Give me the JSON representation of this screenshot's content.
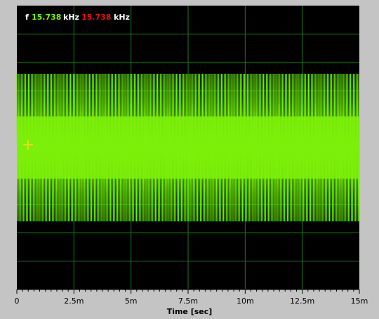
{
  "readout": {
    "f_label": "f",
    "freq_green": "15.738",
    "unit_green": "kHz",
    "freq_red": "15.738",
    "unit_red": "kHz"
  },
  "colors": {
    "trace": "#6cf500",
    "trace_dense": "#7df00a",
    "grid": "#1e7a1e",
    "background": "#000000",
    "label_green": "#7cf000",
    "label_red": "#e01010",
    "cursor": "#f0e020"
  },
  "chart_data": {
    "type": "line",
    "title": "",
    "xlabel": "Time [sec]",
    "ylabel": "",
    "x_ticks": [
      "0",
      "2.5m",
      "5m",
      "7.5m",
      "10m",
      "12.5m",
      "15m"
    ],
    "xlim": [
      0,
      0.015
    ],
    "grid": true,
    "series": [
      {
        "frequency_hz": 15738,
        "x_start": 0,
        "x_end": 0.015,
        "envelope_outer": [
          -0.52,
          0.52
        ],
        "envelope_inner": [
          -0.22,
          0.22
        ],
        "color": "#6cf500"
      }
    ]
  },
  "icons": {
    "cursor": "crosshair-cursor-icon"
  }
}
